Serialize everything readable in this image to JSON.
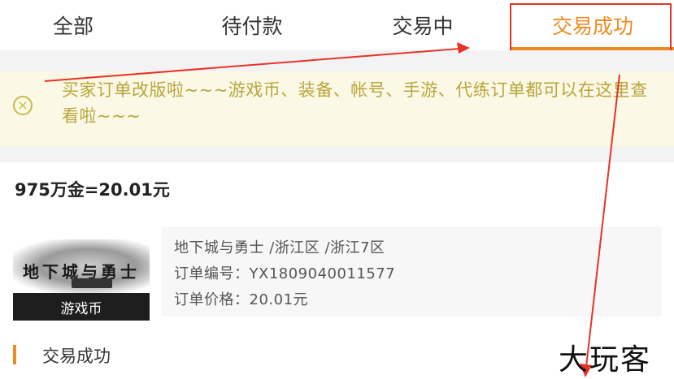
{
  "tabs": [
    {
      "label": "全部",
      "active": false
    },
    {
      "label": "待付款",
      "active": false
    },
    {
      "label": "交易中",
      "active": false
    },
    {
      "label": "交易成功",
      "active": true
    }
  ],
  "notice": {
    "icon": "close-circle-icon",
    "text": "买家订单改版啦~~~游戏币、装备、帐号、手游、代练订单都可以在这里查看啦~~~"
  },
  "order": {
    "title": "975万金=20.01元",
    "thumbnail_label": "游戏币",
    "game_line": "地下城与勇士 /浙江区 /浙江7区",
    "order_no_line": "订单编号：YX1809040011577",
    "price_line": "订单价格：20.01元"
  },
  "status": {
    "text": "交易成功"
  },
  "watermark": "大玩客",
  "colors": {
    "accent": "#ef8a23",
    "annotation": "#e63329",
    "notice_text": "#b9a53c"
  }
}
